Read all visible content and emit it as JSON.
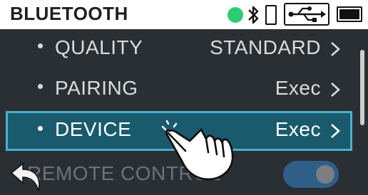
{
  "header": {
    "title": "BLUETOOTH",
    "status_icons": [
      "connected-dot-icon",
      "bluetooth-icon",
      "phone-icon",
      "usb-icon",
      "battery-icon"
    ],
    "connected_color": "#2ecc71"
  },
  "menu": {
    "items": [
      {
        "label": "QUALITY",
        "value": "STANDARD"
      },
      {
        "label": "PAIRING",
        "value": "Exec"
      },
      {
        "label": "DEVICE",
        "value": "Exec"
      }
    ],
    "selected_index": 2,
    "selected_border_color": "#4ab0cf",
    "selected_bg_color": "#1a5a6d"
  },
  "bottom": {
    "label": "REMOTE CONTROL",
    "toggle_on": true,
    "toggle_color": "#2f5f88"
  },
  "icons": {
    "back": "back-arrow-icon",
    "touch": "tap-hand-icon",
    "chevron": "chevron-right-icon"
  }
}
